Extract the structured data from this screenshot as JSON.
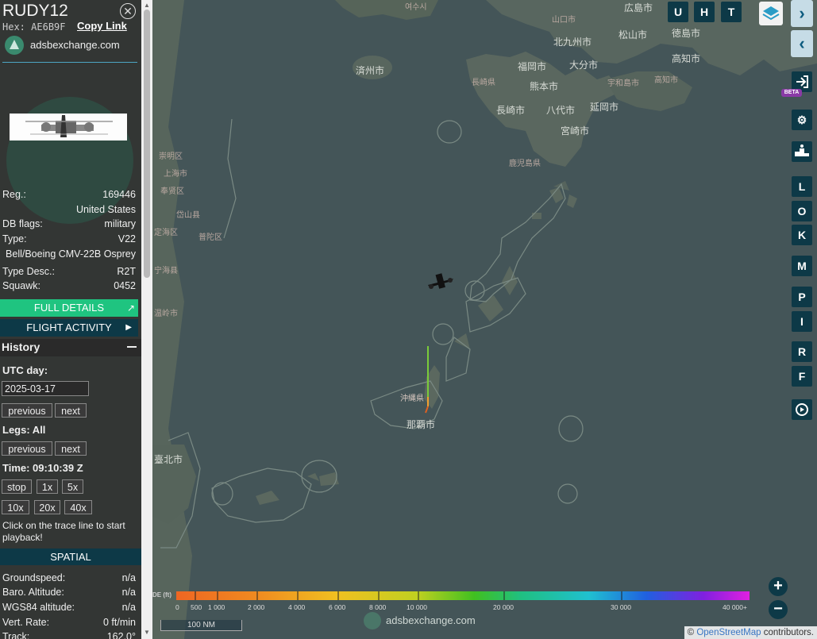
{
  "aircraft": {
    "callsign": "RUDY12",
    "hex_label": "Hex:",
    "hex": "AE6B9F",
    "copy_link": "Copy Link",
    "source": "adsbexchange.com"
  },
  "details": {
    "reg_label": "Reg.:",
    "reg": "169446",
    "country": "United States",
    "dbflags_label": "DB flags:",
    "dbflags": "military",
    "type_label": "Type:",
    "type": "V22",
    "type_full": "Bell/Boeing CMV-22B Osprey",
    "typedesc_label": "Type Desc.:",
    "typedesc": "R2T",
    "squawk_label": "Squawk:",
    "squawk": "0452"
  },
  "buttons": {
    "full_details": "FULL DETAILS",
    "flight_activity": "FLIGHT ACTIVITY"
  },
  "history": {
    "title": "History",
    "utc_day_label": "UTC day:",
    "date": "2025-03-17",
    "previous": "previous",
    "next": "next",
    "legs_label": "Legs: All",
    "time_label": "Time: 09:10:39 Z",
    "speeds": [
      "stop",
      "1x",
      "5x",
      "10x",
      "20x",
      "40x"
    ],
    "hint": "Click on the trace line to start playback!"
  },
  "spatial": {
    "title": "SPATIAL",
    "groundspeed_label": "Groundspeed:",
    "groundspeed": "n/a",
    "baro_label": "Baro. Altitude:",
    "baro": "n/a",
    "wgs_label": "WGS84 altitude:",
    "wgs": "n/a",
    "vert_label": "Vert. Rate:",
    "vert": "0 ft/min",
    "track_label": "Track:",
    "track": "162.0°"
  },
  "map": {
    "cities": {
      "hiroshima": "広島市",
      "yamaguchi": "山口市",
      "kitakyushu": "北九州市",
      "matsuyama": "松山市",
      "tokushima": "徳島市",
      "fukuoka": "福岡市",
      "oita": "大分市",
      "kochi": "高知市",
      "nagasaki_pref": "長崎県",
      "kumamoto": "熊本市",
      "uwajima": "宇和島市",
      "nagasaki": "長崎市",
      "yatsushiro": "八代市",
      "nobeoka": "延岡市",
      "miyazaki": "宮崎市",
      "kagoshima_pref": "鹿児島県",
      "jeju": "済州市",
      "yeosu": "여수시",
      "okinawa_pref": "沖縄県",
      "naha": "那覇市",
      "taipei": "臺北市",
      "chongming": "崇明区",
      "shanghai": "上海市",
      "fengxian": "奉贤区",
      "daishan": "岱山县",
      "dinghai": "定海区",
      "putuo": "普陀区",
      "ninghai": "宁海县",
      "wenling": "温岭市"
    },
    "toolbar": {
      "u": "U",
      "h": "H",
      "t": "T"
    },
    "side_letters": [
      "L",
      "O",
      "K",
      "M",
      "P",
      "I",
      "R",
      "F"
    ],
    "beta": "BETA",
    "zoom_in": "+",
    "zoom_out": "−",
    "scale": "100 NM",
    "watermark": "adsbexchange.com",
    "attribution_prefix": "©",
    "attribution_link": "OpenStreetMap",
    "attribution_suffix": "contributors.",
    "altitude_legend": {
      "title": "DE (ft)",
      "labels": [
        "0",
        "500",
        "1 000",
        "2 000",
        "4 000",
        "6 000",
        "8 000",
        "10 000",
        "20 000",
        "30 000",
        "40 000+"
      ]
    }
  }
}
